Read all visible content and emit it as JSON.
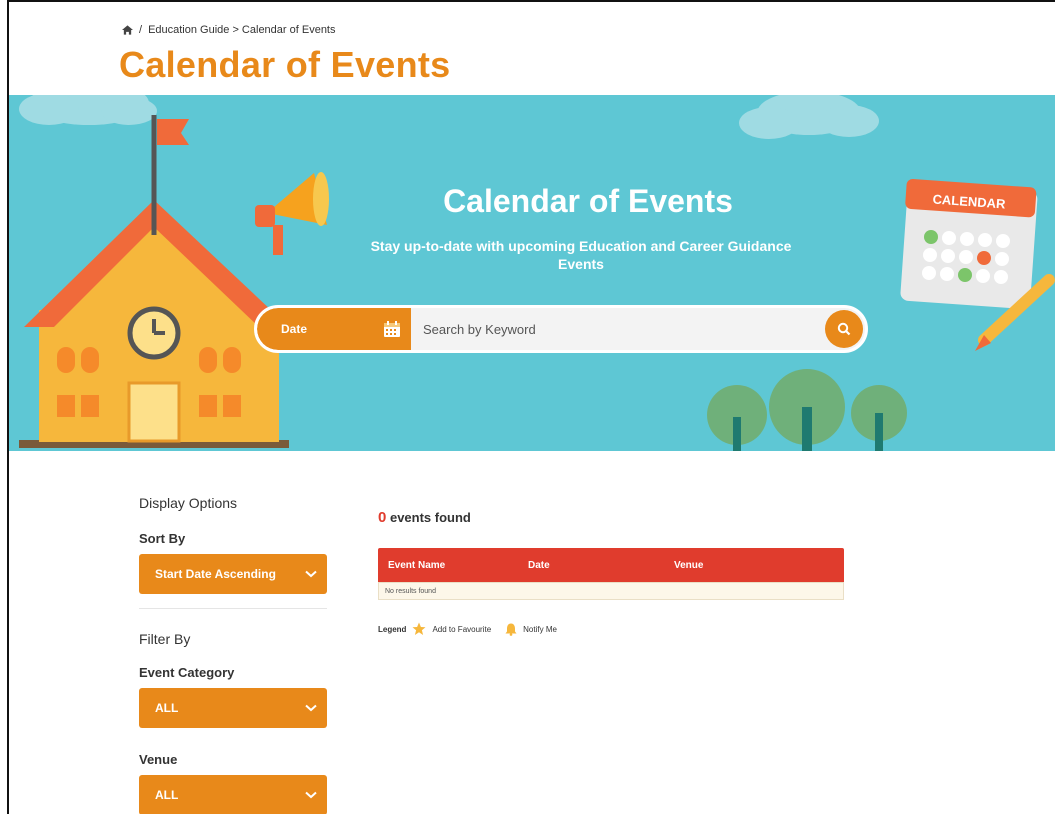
{
  "breadcrumb": {
    "separator": "/",
    "path": "Education Guide > Calendar of Events"
  },
  "page_title": "Calendar of Events",
  "banner": {
    "title": "Calendar of Events",
    "subtitle": "Stay up-to-date with upcoming Education and Career Guidance Events",
    "calendar_sign": "CALENDAR"
  },
  "search": {
    "date_label": "Date",
    "keyword_placeholder": "Search by Keyword"
  },
  "sidebar": {
    "display_options": "Display Options",
    "sort_by_label": "Sort By",
    "sort_by_value": "Start Date Ascending",
    "filter_by": "Filter By",
    "event_category_label": "Event Category",
    "event_category_value": "ALL",
    "venue_label": "Venue",
    "venue_value": "ALL"
  },
  "results": {
    "count": "0",
    "count_suffix": "events found",
    "columns": [
      "Event Name",
      "Date",
      "Venue"
    ],
    "empty_message": "No results found"
  },
  "legend": {
    "label": "Legend",
    "favourite": "Add to Favourite",
    "notify": "Notify Me"
  },
  "colors": {
    "accent": "#e8891a",
    "banner": "#5ec7d4",
    "table_header": "#e03c2d"
  },
  "icons": [
    "home-icon",
    "calendar-icon",
    "search-icon",
    "chevron-down-icon",
    "star-icon",
    "bell-icon"
  ]
}
